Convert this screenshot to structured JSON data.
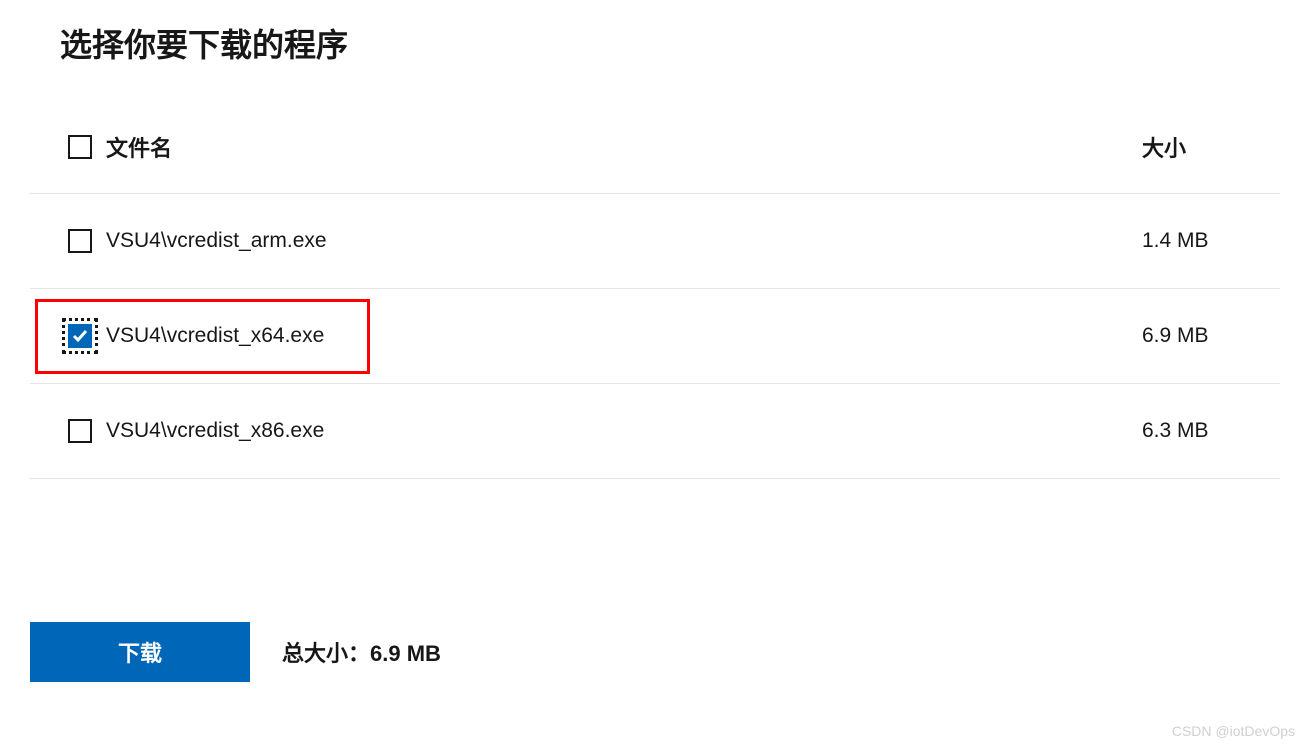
{
  "page": {
    "title": "选择你要下载的程序"
  },
  "table": {
    "headers": {
      "filename": "文件名",
      "size": "大小"
    },
    "rows": [
      {
        "filename": "VSU4\\vcredist_arm.exe",
        "size": "1.4 MB",
        "checked": false,
        "highlight": false,
        "focus": false
      },
      {
        "filename": "VSU4\\vcredist_x64.exe",
        "size": "6.9 MB",
        "checked": true,
        "highlight": true,
        "focus": true
      },
      {
        "filename": "VSU4\\vcredist_x86.exe",
        "size": "6.3 MB",
        "checked": false,
        "highlight": false,
        "focus": false
      }
    ]
  },
  "footer": {
    "download_label": "下载",
    "total_size_label": "总大小：",
    "total_size_value": "6.9 MB"
  },
  "watermark": "CSDN @iotDevOps"
}
